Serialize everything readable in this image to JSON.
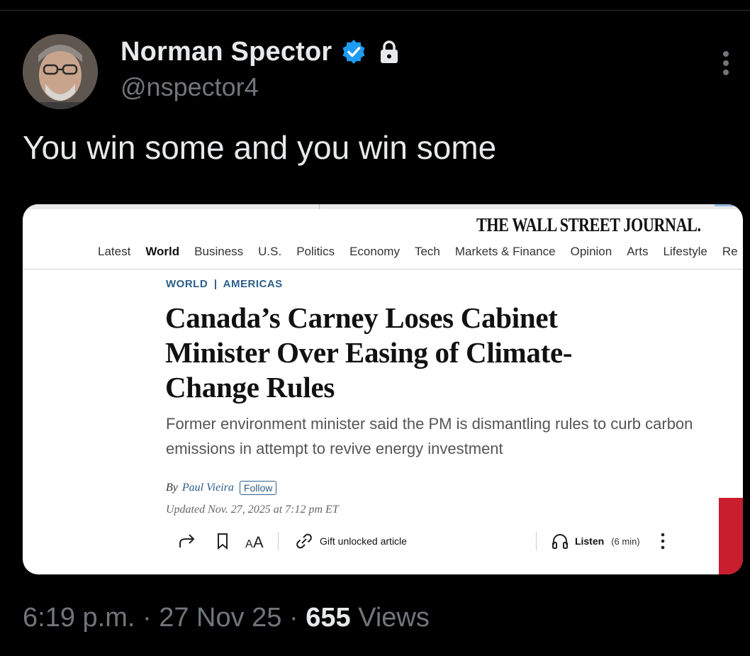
{
  "author": {
    "name": "Norman Spector",
    "handle": "@nspector4",
    "verified_color": "#1d9bf0"
  },
  "tweet": {
    "text": "You win some and you win some"
  },
  "article": {
    "masthead": "THE WALL STREET JOURNAL.",
    "nav": [
      "Latest",
      "World",
      "Business",
      "U.S.",
      "Politics",
      "Economy",
      "Tech",
      "Markets & Finance",
      "Opinion",
      "Arts",
      "Lifestyle",
      "Re"
    ],
    "active_nav": "World",
    "section_1": "WORLD",
    "section_sep": "|",
    "section_2": "AMERICAS",
    "headline": "Canada’s Carney Loses Cabinet Minister Over Easing of Climate-Change Rules",
    "dek": "Former environment minister said the PM is dismantling rules to curb carbon emissions in attempt to revive energy investment",
    "byline_prefix": "By",
    "author": "Paul Vieira",
    "follow_label": "Follow",
    "updated": "Updated Nov. 27, 2025 at 7:12 pm ET",
    "gift_label": "Gift unlocked article",
    "listen_label": "Listen",
    "listen_duration": "(6 min)"
  },
  "footer": {
    "time": "6:19 p.m.",
    "sep": "·",
    "date": "27 Nov 25",
    "views_count": "655",
    "views_label": "Views"
  }
}
